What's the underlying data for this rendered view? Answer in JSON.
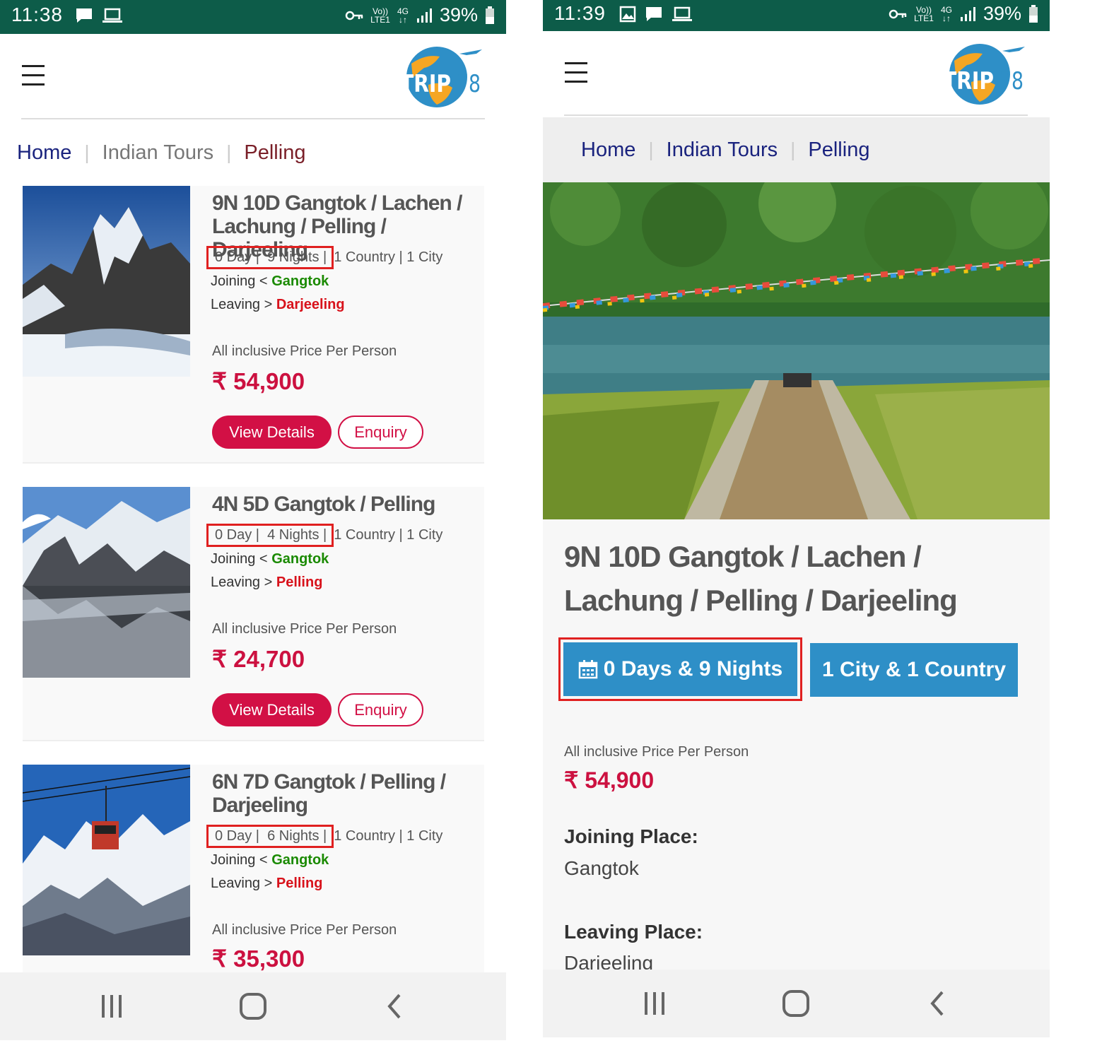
{
  "left": {
    "status": {
      "time": "11:38",
      "volte": "Vo))",
      "lte": "LTE1",
      "network": "4G",
      "battery": "39%"
    },
    "breadcrumb": {
      "home": "Home",
      "section": "Indian Tours",
      "current": "Pelling"
    },
    "cards": [
      {
        "title": "9N 10D Gangtok / Lachen / Lachung / Pelling / Darjeeling",
        "days": "0 Day |",
        "nights": "9 Nights |",
        "extra": "1 Country | 1 City",
        "joining_label": "Joining <",
        "joining": "Gangtok",
        "leaving_label": "Leaving >",
        "leaving": "Darjeeling",
        "price_label": "All inclusive Price Per Person",
        "price": "₹ 54,900",
        "view_label": "View Details",
        "enquiry_label": "Enquiry"
      },
      {
        "title": "4N 5D Gangtok / Pelling",
        "days": "0 Day |",
        "nights": "4 Nights |",
        "extra": "1 Country | 1 City",
        "joining_label": "Joining <",
        "joining": "Gangtok",
        "leaving_label": "Leaving >",
        "leaving": "Pelling",
        "price_label": "All inclusive Price Per Person",
        "price": "₹ 24,700",
        "view_label": "View Details",
        "enquiry_label": "Enquiry"
      },
      {
        "title": "6N 7D Gangtok / Pelling / Darjeeling",
        "days": "0 Day |",
        "nights": "6 Nights |",
        "extra": "1 Country | 1 City",
        "joining_label": "Joining <",
        "joining": "Gangtok",
        "leaving_label": "Leaving >",
        "leaving": "Pelling",
        "price_label": "All inclusive Price Per Person",
        "price": "₹ 35,300"
      }
    ]
  },
  "right": {
    "status": {
      "time": "11:39",
      "volte": "Vo))",
      "lte": "LTE1",
      "network": "4G",
      "battery": "39%"
    },
    "breadcrumb": {
      "home": "Home",
      "section": "Indian Tours",
      "current": "Pelling"
    },
    "detail": {
      "title": "9N 10D Gangtok / Lachen / Lachung / Pelling / Darjeeling",
      "duration_badge": "0 Days & 9 Nights",
      "location_badge": "1 City & 1 Country",
      "price_label": "All inclusive Price Per Person",
      "price": "₹ 54,900",
      "joining_heading": "Joining Place:",
      "joining_value": "Gangtok",
      "leaving_heading": "Leaving Place:",
      "leaving_value": "Darjeeling"
    }
  },
  "logo": {
    "text_left": "TRIP",
    "text_right": "78"
  },
  "colors": {
    "status_bar": "#0d5c49",
    "accent": "#d21045",
    "badge": "#2e8fc7",
    "link": "#1a237e",
    "current_crumb": "#7a1f28",
    "highlight_box": "#e02020"
  },
  "icons": [
    "message-icon",
    "laptop-icon",
    "image-icon",
    "key-icon",
    "signal-icon",
    "battery-icon",
    "hamburger-icon",
    "calendar-icon",
    "recents-icon",
    "home-icon",
    "back-icon"
  ]
}
